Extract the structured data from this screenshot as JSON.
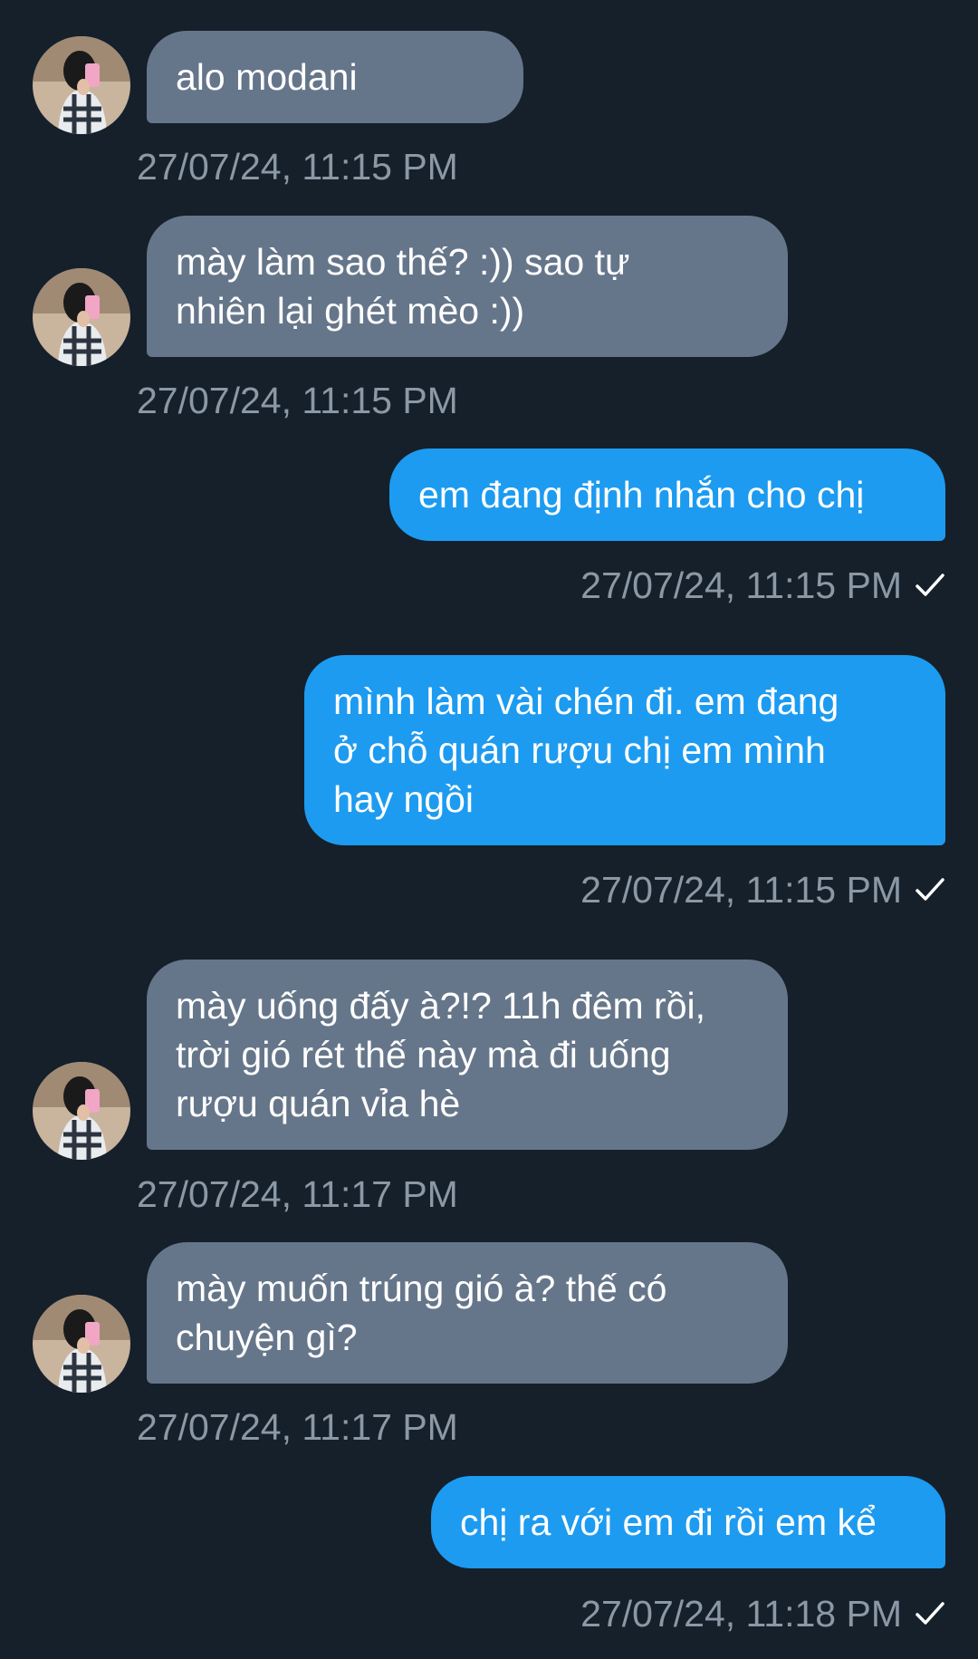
{
  "colors": {
    "background": "#15202b",
    "received_bubble": "#66768a",
    "sent_bubble": "#1d9bf0",
    "timestamp": "#8b98a5"
  },
  "messages": [
    {
      "direction": "received",
      "text": "alo modani",
      "time": "27/07/24, 11:15 PM"
    },
    {
      "direction": "received",
      "text": "mày làm sao thế? :)) sao tự\nnhiên lại ghét mèo :))",
      "time": "27/07/24, 11:15 PM"
    },
    {
      "direction": "sent",
      "text": "em đang định nhắn cho chị",
      "time": "27/07/24, 11:15 PM",
      "status_icon": "check-icon"
    },
    {
      "direction": "sent",
      "text": "mình làm vài chén đi. em đang\nở chỗ quán rượu chị em mình\nhay ngồi",
      "time": "27/07/24, 11:15 PM",
      "status_icon": "check-icon"
    },
    {
      "direction": "received",
      "text": "mày uống đấy à?!? 11h đêm rồi,\ntrời gió rét thế này mà đi uống\nrượu quán vỉa hè",
      "time": "27/07/24, 11:17 PM"
    },
    {
      "direction": "received",
      "text": "mày muốn trúng gió à? thế có\nchuyện gì?",
      "time": "27/07/24, 11:17 PM"
    },
    {
      "direction": "sent",
      "text": "chị ra với em đi rồi em kể",
      "time": "27/07/24, 11:18 PM",
      "status_icon": "check-icon"
    }
  ]
}
